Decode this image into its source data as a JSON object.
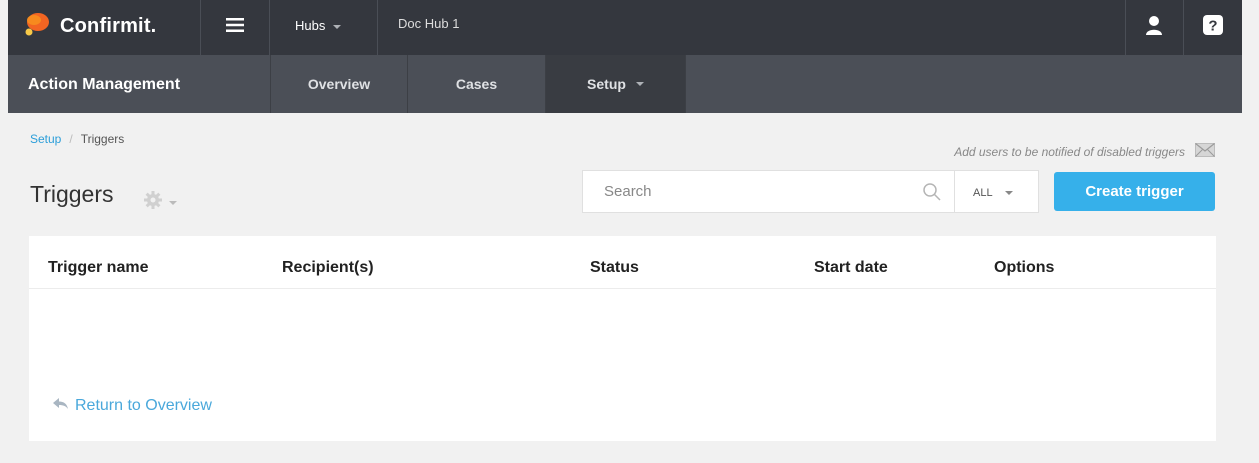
{
  "header": {
    "brand": "Confirmit.",
    "hubs_label": "Hubs",
    "hub_name": "Doc Hub 1"
  },
  "module": {
    "title": "Action Management",
    "tabs": [
      {
        "label": "Overview"
      },
      {
        "label": "Cases"
      },
      {
        "label": "Setup"
      }
    ]
  },
  "breadcrumb": {
    "parent": "Setup",
    "separator": "/",
    "current": "Triggers"
  },
  "notify_text": "Add users to be notified of disabled triggers",
  "page_title": "Triggers",
  "search": {
    "placeholder": "Search",
    "filter_value": "ALL"
  },
  "create_button": "Create trigger",
  "table": {
    "columns": [
      "Trigger name",
      "Recipient(s)",
      "Status",
      "Start date",
      "Options"
    ],
    "rows": []
  },
  "return_link": "Return to Overview",
  "colors": {
    "topbar": "#34373e",
    "modbar": "#4b4f57",
    "accent": "#36b0ea",
    "link": "#2b9ed9",
    "logo_orange": "#f26522"
  },
  "icons": [
    "confirmit-logo-icon",
    "hamburger-icon",
    "user-icon",
    "help-icon",
    "mail-icon",
    "gear-icon",
    "search-icon",
    "return-arrow-icon"
  ]
}
